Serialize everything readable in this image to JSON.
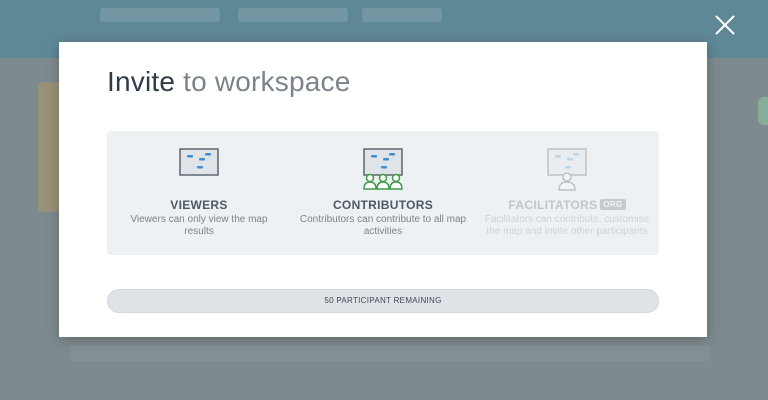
{
  "modal": {
    "title_bold": "Invite",
    "title_rest": "to workspace",
    "roles": [
      {
        "name": "VIEWERS",
        "description": "Viewers can only view the map results",
        "icon": "map-board-icon"
      },
      {
        "name": "CONTRIBUTORS",
        "description": "Contributors can contribute to all map activities",
        "icon": "map-board-group-icon"
      },
      {
        "name": "FACILITATORS",
        "badge": "ORG",
        "description": "Facilitators can contribute, customise the map and invite other participants",
        "icon": "map-board-person-icon"
      }
    ],
    "participants_remaining": "50 PARTICIPANT REMAINING"
  },
  "colors": {
    "accent_blue": "#3d8fd1",
    "contributors_green": "#3e9b47",
    "panel_bg": "#eef1f4"
  },
  "icons": {
    "close": "close-icon"
  }
}
